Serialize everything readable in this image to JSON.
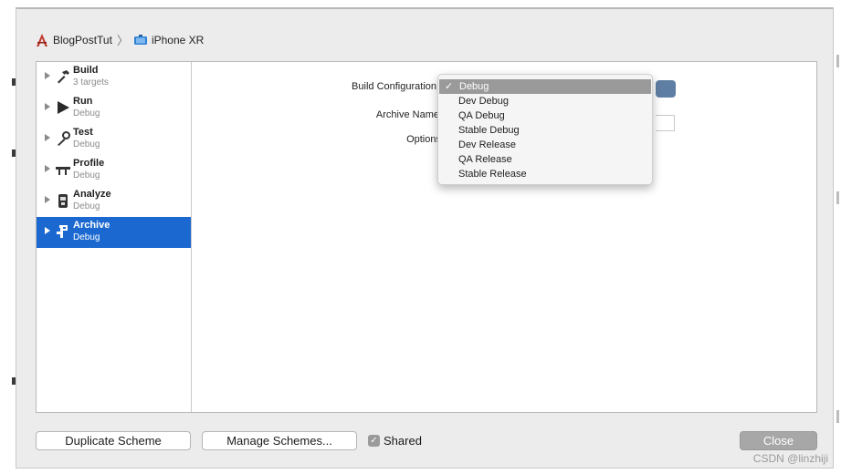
{
  "breadcrumb": {
    "project": "BlogPostTut",
    "device": "iPhone XR"
  },
  "actions": [
    {
      "title": "Build",
      "subtitle": "3 targets",
      "icon": "hammer-icon"
    },
    {
      "title": "Run",
      "subtitle": "Debug",
      "icon": "play-icon"
    },
    {
      "title": "Test",
      "subtitle": "Debug",
      "icon": "wrench-icon"
    },
    {
      "title": "Profile",
      "subtitle": "Debug",
      "icon": "gauge-icon"
    },
    {
      "title": "Analyze",
      "subtitle": "Debug",
      "icon": "analyze-icon"
    },
    {
      "title": "Archive",
      "subtitle": "Debug",
      "icon": "archive-icon"
    }
  ],
  "selected_action": "Archive",
  "form": {
    "build_configuration_label": "Build Configuration",
    "archive_name_label": "Archive Name",
    "options_label": "Options"
  },
  "dropdown": {
    "selected": "Debug",
    "items": [
      "Debug",
      "Dev Debug",
      "QA Debug",
      "Stable Debug",
      "Dev Release",
      "QA Release",
      "Stable Release"
    ],
    "check": "✓"
  },
  "footer": {
    "duplicate_label": "Duplicate Scheme",
    "manage_label": "Manage Schemes...",
    "shared_label": "Shared",
    "shared_checked": true,
    "close_label": "Close",
    "watermark": "CSDN @linzhiji"
  },
  "colors": {
    "selection": "#1b69d0",
    "menu_highlight": "#9a9a9a"
  }
}
